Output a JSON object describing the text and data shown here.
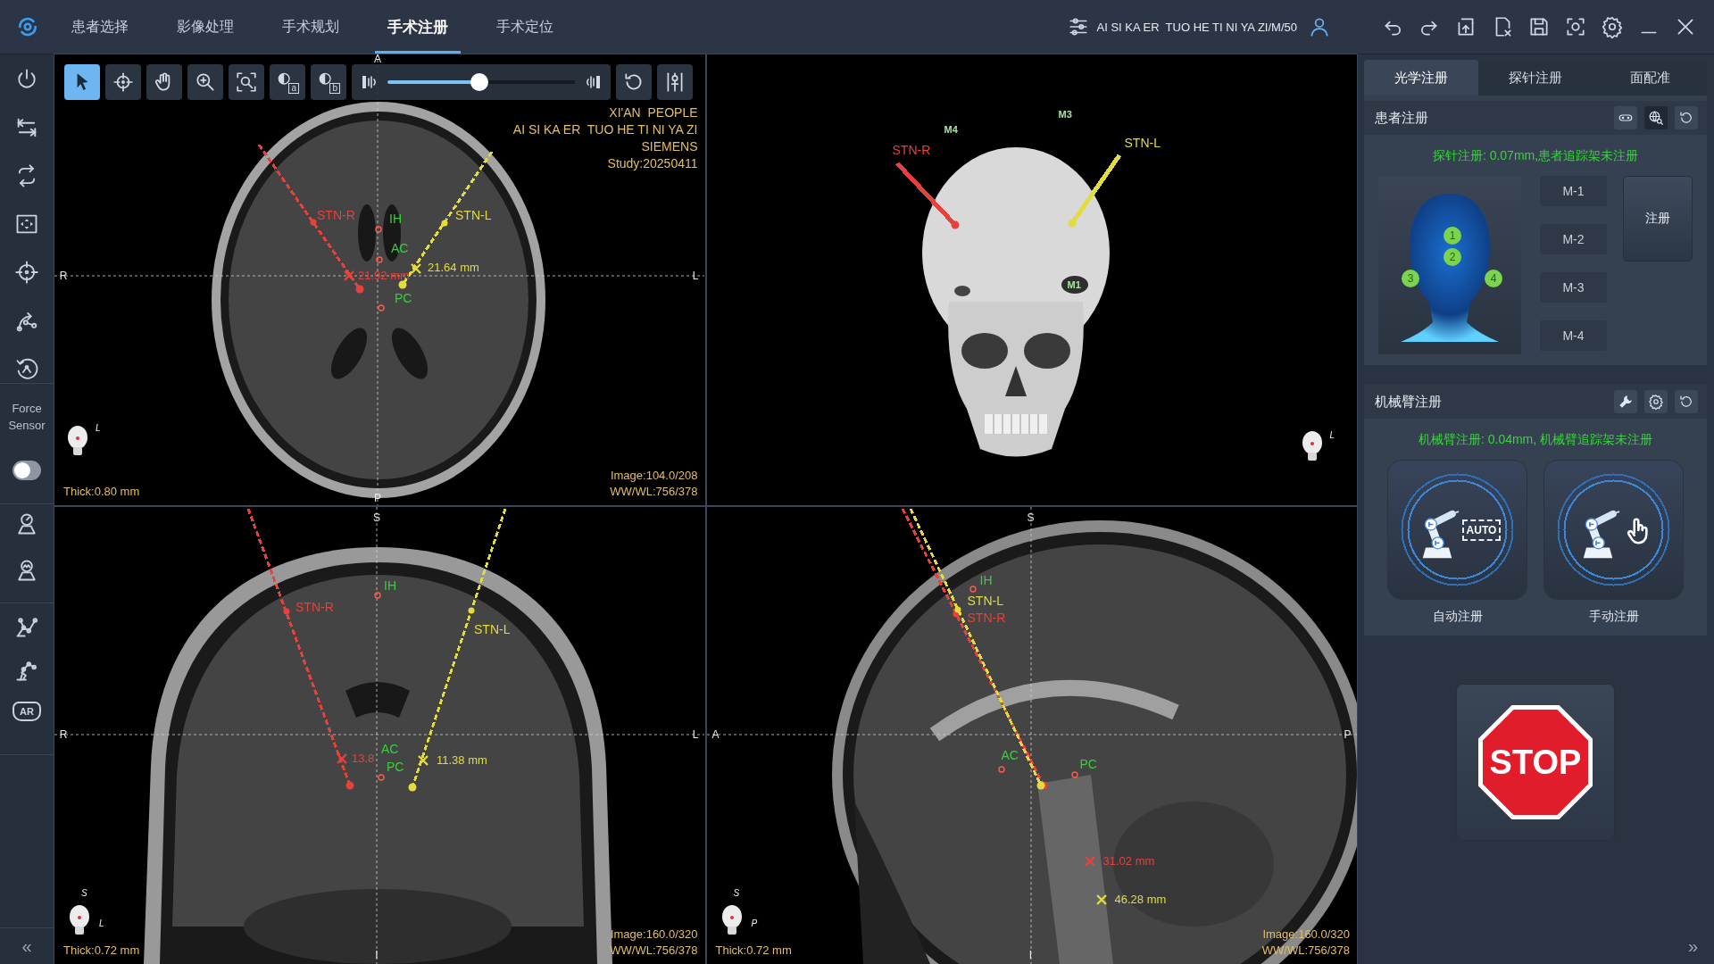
{
  "top_bar": {
    "tabs": [
      {
        "label": "患者选择",
        "selected": false
      },
      {
        "label": "影像处理",
        "selected": false
      },
      {
        "label": "手术规划",
        "selected": false
      },
      {
        "label": "手术注册",
        "selected": true
      },
      {
        "label": "手术定位",
        "selected": false
      }
    ],
    "patient": "AI SI KA ER  TUO HE TI NI YA ZI/M/50"
  },
  "sidebar": {
    "force_sensor": {
      "label": "Force Sensor",
      "on": false
    },
    "ar_label": "AR",
    "collapse": "«"
  },
  "viewports": [
    {
      "kind": "axial",
      "toolbar": {
        "tools": [
          {
            "selected": true
          },
          {
            "selected": false
          },
          {
            "selected": false
          },
          {
            "selected": false
          },
          {
            "selected": false
          },
          {
            "selected": false,
            "badge": "a"
          },
          {
            "selected": false,
            "badge": "b"
          }
        ],
        "slider": {
          "level": 0.49
        },
        "actions": [
          {
            "selected": false
          },
          {
            "selected": false
          }
        ]
      },
      "orientation": {
        "top": "A",
        "bottom": "P",
        "left": "R",
        "right": "L"
      },
      "info": [
        "XI'AN  PEOPLE",
        "AI SI KA ER  TUO HE TI NI YA ZI",
        "SIEMENS",
        "Study:20250411"
      ],
      "axis_letters": [
        "L"
      ],
      "thickness": "Thick:0.80 mm",
      "image_info": [
        "Image:104.0/208",
        "WW/WL:756/378"
      ],
      "trajectories": [
        {
          "color": "#e8413c"
        },
        {
          "color": "#e3dc3f"
        }
      ],
      "annotations": [
        {
          "kind": "label",
          "text": "STN-R",
          "color": "#e8413c"
        },
        {
          "kind": "landmark",
          "text": "IH",
          "color": "#36d13a"
        },
        {
          "kind": "label",
          "text": "STN-L",
          "color": "#e3dc3f"
        },
        {
          "kind": "landmark",
          "text": "AC",
          "color": "#36d13a"
        },
        {
          "kind": "measurement",
          "text": "21.92 mm",
          "color": "#e8413c"
        },
        {
          "kind": "measurement",
          "text": "21.64 mm",
          "color": "#e3dc3f"
        },
        {
          "kind": "landmark",
          "text": "PC",
          "color": "#36d13a"
        }
      ]
    },
    {
      "kind": "volume",
      "axis_letters": [
        "L"
      ],
      "trajectories": [
        {
          "color": "#e8413c"
        },
        {
          "color": "#e3dc3f"
        }
      ],
      "annotations": [
        {
          "kind": "label",
          "text": "STN-R",
          "color": "#e8413c"
        },
        {
          "kind": "label",
          "text": "STN-L",
          "color": "#e3dc3f"
        },
        {
          "kind": "marker",
          "text": "M4",
          "color": "#a8e6a0"
        },
        {
          "kind": "marker",
          "text": "M3",
          "color": "#a8e6a0"
        },
        {
          "kind": "marker",
          "text": "M1",
          "color": "#a8e6a0"
        }
      ]
    },
    {
      "kind": "coronal",
      "orientation": {
        "top": "S",
        "bottom": "I",
        "left": "R",
        "right": "L"
      },
      "axis_letters": [
        "S",
        "L"
      ],
      "thickness": "Thick:0.72 mm",
      "image_info": [
        "Image:160.0/320",
        "WW/WL:756/378"
      ],
      "trajectories": [
        {
          "color": "#e8413c"
        },
        {
          "color": "#e3dc3f"
        }
      ],
      "annotations": [
        {
          "kind": "label",
          "text": "STN-R",
          "color": "#e8413c"
        },
        {
          "kind": "landmark",
          "text": "IH",
          "color": "#36d13a"
        },
        {
          "kind": "label",
          "text": "STN-L",
          "color": "#e3dc3f"
        },
        {
          "kind": "measurement",
          "text": "13.8",
          "color": "#e8413c"
        },
        {
          "kind": "landmark",
          "text": "AC",
          "color": "#36d13a"
        },
        {
          "kind": "landmark",
          "text": "PC",
          "color": "#36d13a"
        },
        {
          "kind": "measurement",
          "text": "11.38 mm",
          "color": "#e3dc3f"
        }
      ]
    },
    {
      "kind": "sagittal",
      "orientation": {
        "top": "S",
        "bottom": "I",
        "left": "A",
        "right": "P"
      },
      "axis_letters": [
        "S",
        "P"
      ],
      "thickness": "Thick:0.72 mm",
      "image_info": [
        "Image:160.0/320",
        "WW/WL:756/378"
      ],
      "trajectories": [
        {
          "color": "#e8413c"
        },
        {
          "color": "#e3dc3f"
        }
      ],
      "annotations": [
        {
          "kind": "landmark",
          "text": "IH",
          "color": "#36d13a"
        },
        {
          "kind": "label",
          "text": "STN-L",
          "color": "#e3dc3f"
        },
        {
          "kind": "label",
          "text": "STN-R",
          "color": "#e8413c"
        },
        {
          "kind": "landmark",
          "text": "AC",
          "color": "#36d13a"
        },
        {
          "kind": "landmark",
          "text": "PC",
          "color": "#36d13a"
        },
        {
          "kind": "measurement",
          "text": "31.02 mm",
          "color": "#e8413c"
        },
        {
          "kind": "measurement",
          "text": "46.28 mm",
          "color": "#e3dc3f"
        }
      ]
    }
  ],
  "panel": {
    "tabs": [
      {
        "label": "光学注册",
        "selected": true
      },
      {
        "label": "探针注册",
        "selected": false
      },
      {
        "label": "面配准",
        "selected": false
      }
    ],
    "patient_registration": {
      "title": "患者注册",
      "actions": [
        {
          "selected": false
        },
        {
          "selected": true
        },
        {
          "selected": false
        }
      ],
      "status": "探针注册: 0.07mm,患者追踪架未注册",
      "landmarks": [
        "1",
        "2",
        "3",
        "4"
      ],
      "markers": [
        "M-1",
        "M-2",
        "M-3",
        "M-4"
      ],
      "register": "注册"
    },
    "robot_registration": {
      "title": "机械臂注册",
      "actions": [
        {
          "selected": false
        },
        {
          "selected": false
        },
        {
          "selected": false
        }
      ],
      "status": "机械臂注册: 0.04mm, 机械臂追踪架未注册",
      "modes": [
        {
          "kind": "auto",
          "badge": "AUTO",
          "label": "自动注册"
        },
        {
          "kind": "manual",
          "label": "手动注册"
        }
      ]
    },
    "stop": "STOP",
    "expand": "»"
  }
}
